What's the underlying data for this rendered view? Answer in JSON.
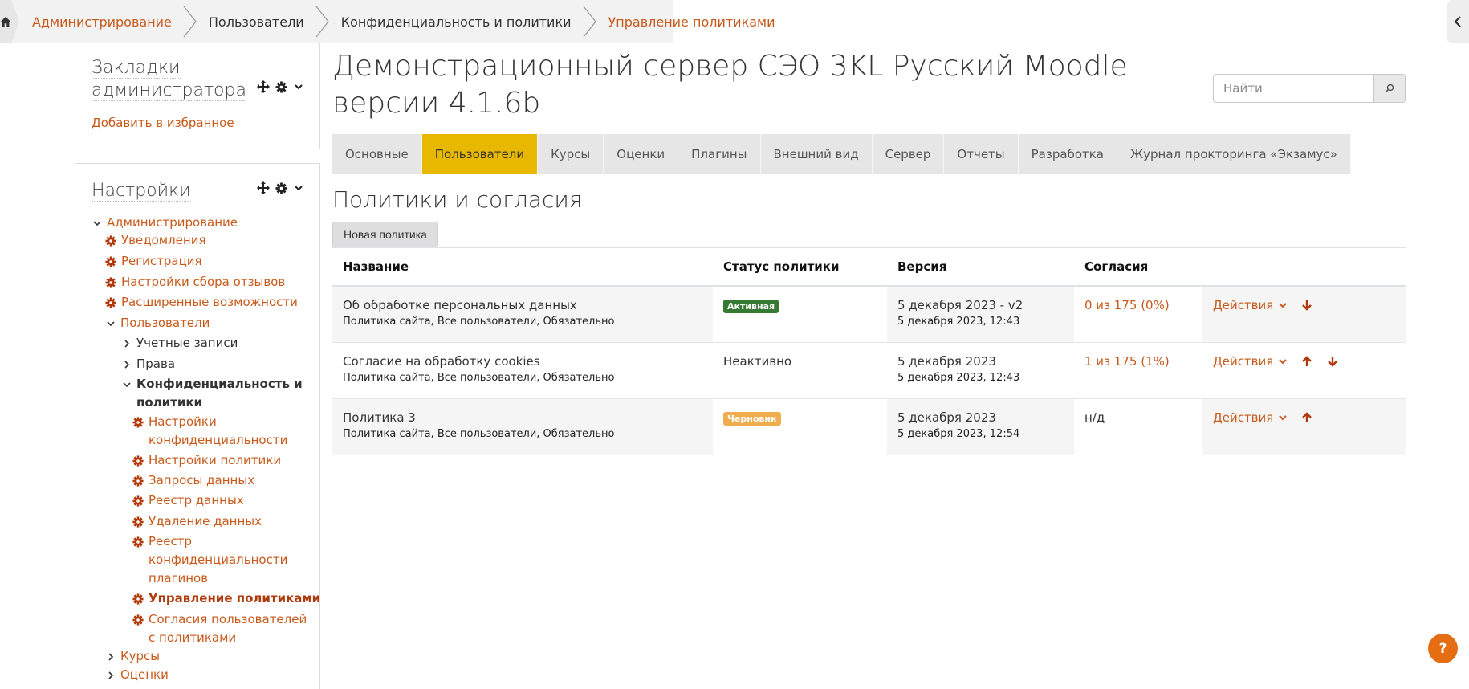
{
  "breadcrumb": {
    "items": [
      {
        "label": "Администрирование"
      },
      {
        "label": "Пользователи"
      },
      {
        "label": "Конфиденциальность и политики"
      },
      {
        "label": "Управление политиками"
      }
    ]
  },
  "bookmarks": {
    "title": "Закладки администратора",
    "add_link": "Добавить в избранное"
  },
  "settings": {
    "title": "Настройки",
    "tree": [
      {
        "label": "Администрирование"
      },
      {
        "label": "Уведомления"
      },
      {
        "label": "Регистрация"
      },
      {
        "label": "Настройки сбора отзывов"
      },
      {
        "label": "Расширенные возможности"
      },
      {
        "label": "Пользователи"
      },
      {
        "label": "Учетные записи"
      },
      {
        "label": "Права"
      },
      {
        "label": "Конфиденциальность и политики"
      },
      {
        "label": "Настройки конфиденциальности"
      },
      {
        "label": "Настройки политики"
      },
      {
        "label": "Запросы данных"
      },
      {
        "label": "Реестр данных"
      },
      {
        "label": "Удаление данных"
      },
      {
        "label": "Реестр конфиденциальности плагинов"
      },
      {
        "label": "Управление политиками"
      },
      {
        "label": "Согласия пользователей с политиками"
      },
      {
        "label": "Курсы"
      },
      {
        "label": "Оценки"
      }
    ]
  },
  "header": {
    "title": "Демонстрационный сервер СЭО 3KL Русский Moodle версии 4.1.6b",
    "search_placeholder": "Найти"
  },
  "tabs": [
    {
      "label": "Основные"
    },
    {
      "label": "Пользователи"
    },
    {
      "label": "Курсы"
    },
    {
      "label": "Оценки"
    },
    {
      "label": "Плагины"
    },
    {
      "label": "Внешний вид"
    },
    {
      "label": "Сервер"
    },
    {
      "label": "Отчеты"
    },
    {
      "label": "Разработка"
    },
    {
      "label": "Журнал прокторинга «Экзамус»"
    }
  ],
  "main": {
    "section_title": "Политики и согласия",
    "new_policy_button": "Новая политика",
    "table": {
      "headers": [
        "Название",
        "Статус политики",
        "Версия",
        "Согласия",
        ""
      ],
      "rows": [
        {
          "name": "Об обработке персональных данных",
          "meta": "Политика сайта, Все пользователи, Обязательно",
          "status": "Активная",
          "version": "5 декабря 2023 - v2",
          "version_date": "5 декабря 2023, 12:43",
          "consents": "0 из 175 (0%)",
          "actions": "Действия"
        },
        {
          "name": "Согласие на обработку cookies",
          "meta": "Политика сайта, Все пользователи, Обязательно",
          "status": "Неактивно",
          "version": "5 декабря 2023",
          "version_date": "5 декабря 2023, 12:43",
          "consents": "1 из 175 (1%)",
          "actions": "Действия"
        },
        {
          "name": "Политика 3",
          "meta": "Политика сайта, Все пользователи, Обязательно",
          "status": "Черновик",
          "version": "5 декабря 2023",
          "version_date": "5 декабря 2023, 12:54",
          "consents": "н/д",
          "actions": "Действия"
        }
      ]
    }
  },
  "help": {
    "label": "?"
  },
  "colors": {
    "accent": "#c85a1c",
    "active_tab": "#e8b800",
    "badge_active": "#357a32",
    "badge_draft": "#f0ad4e"
  }
}
